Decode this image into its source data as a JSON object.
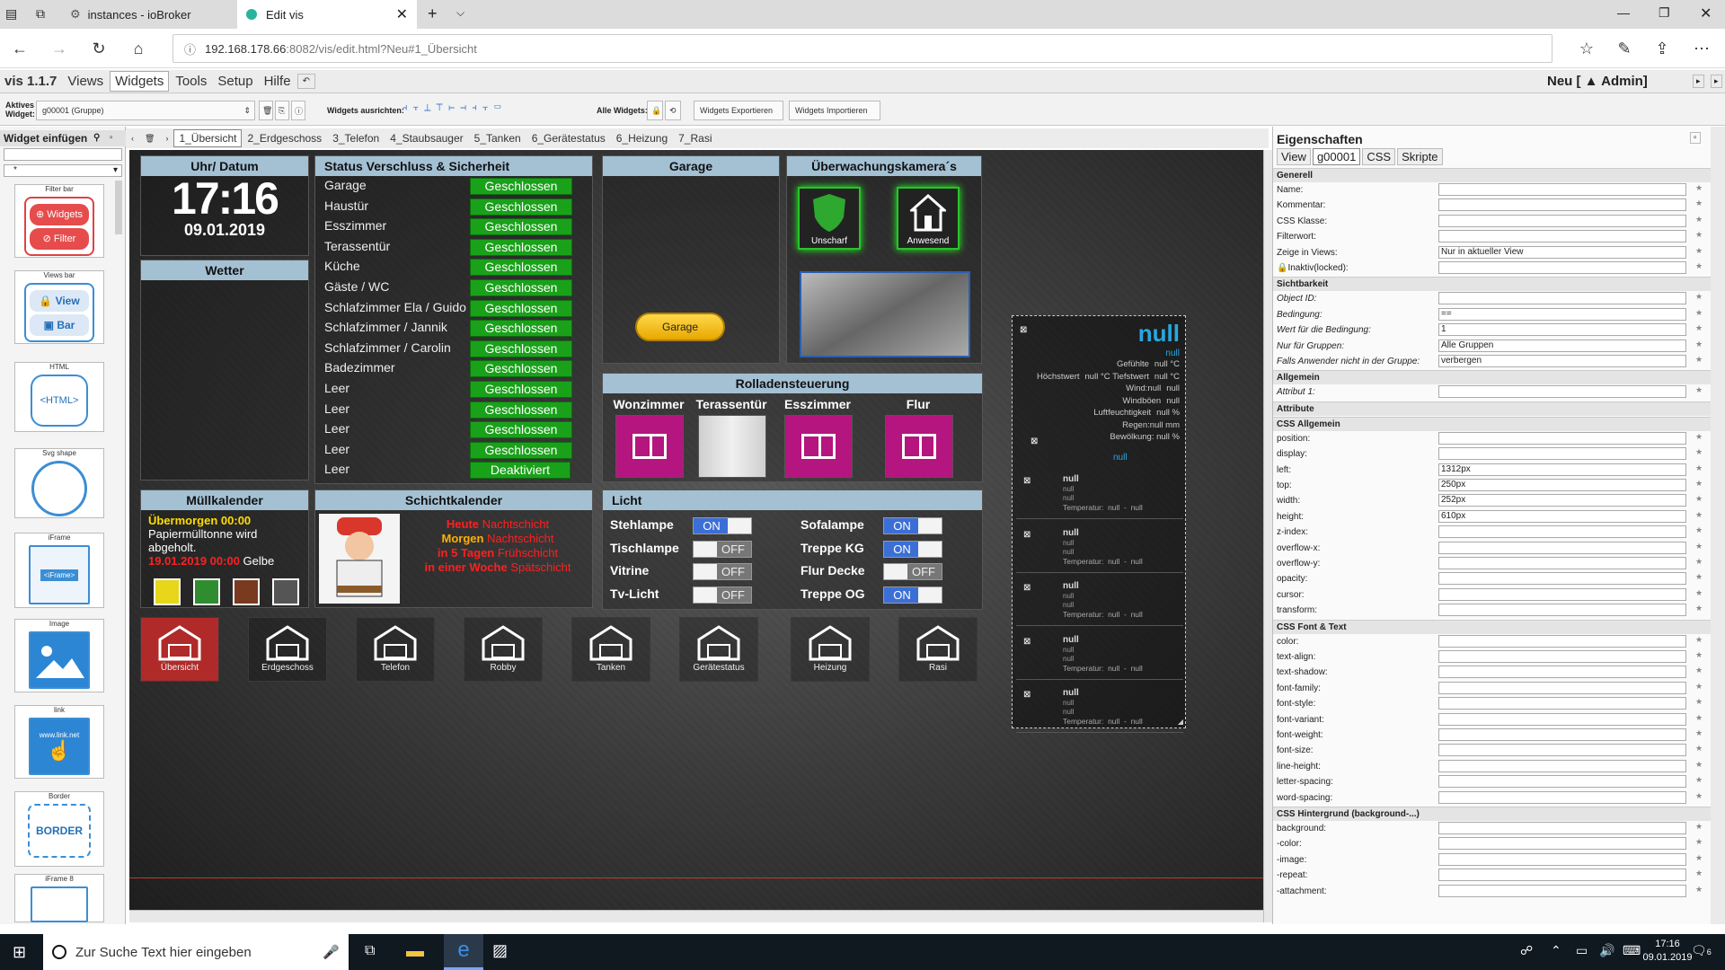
{
  "browser": {
    "tab1": "instances - ioBroker",
    "tab2": "Edit vis",
    "url_host": "192.168.178.66",
    "url_path": ":8082/vis/edit.html?Neu#1_Übersicht"
  },
  "vis": {
    "version": "vis 1.1.7",
    "menu": [
      "Views",
      "Widgets",
      "Tools",
      "Setup",
      "Hilfe"
    ],
    "project": "Neu [ ▲ Admin]"
  },
  "toolbar": {
    "active_label": "Aktives Widget:",
    "active_value": "g00001 (Gruppe)",
    "align_label": "Widgets ausrichten:",
    "all_label": "Alle Widgets:",
    "export": "Widgets Exportieren",
    "import": "Widgets Importieren"
  },
  "left": {
    "title": "Widget einfügen",
    "filter": "*",
    "cards": [
      {
        "label": "Filter bar",
        "a": "Widgets",
        "b": "Filter"
      },
      {
        "label": "Views bar",
        "a": "View",
        "b": "Bar"
      },
      {
        "label": "HTML",
        "a": "<HTML>"
      },
      {
        "label": "Svg shape"
      },
      {
        "label": "iFrame",
        "a": "<iFrame>"
      },
      {
        "label": "Image"
      },
      {
        "label": "link",
        "a": "www.link.net"
      },
      {
        "label": "Border",
        "a": "BORDER"
      },
      {
        "label": "iFrame 8"
      }
    ]
  },
  "view_tabs": [
    "1_Übersicht",
    "2_Erdgeschoss",
    "3_Telefon",
    "4_Staubsauger",
    "5_Tanken",
    "6_Gerätestatus",
    "6_Heizung",
    "7_Rasi"
  ],
  "clock": {
    "title": "Uhr/ Datum",
    "time": "17:16",
    "date": "09.01.2019"
  },
  "weather": {
    "title": "Wetter"
  },
  "status": {
    "title": "Status Verschluss & Sicherheit",
    "rows": [
      [
        "Garage",
        "Geschlossen"
      ],
      [
        "Haustür",
        "Geschlossen"
      ],
      [
        "Esszimmer",
        "Geschlossen"
      ],
      [
        "Terassentür",
        "Geschlossen"
      ],
      [
        "Küche",
        "Geschlossen"
      ],
      [
        "Gäste / WC",
        "Geschlossen"
      ],
      [
        "Schlafzimmer Ela / Guido",
        "Geschlossen"
      ],
      [
        "Schlafzimmer / Jannik",
        "Geschlossen"
      ],
      [
        "Schlafzimmer / Carolin",
        "Geschlossen"
      ],
      [
        "Badezimmer",
        "Geschlossen"
      ],
      [
        "Leer",
        "Geschlossen"
      ],
      [
        "Leer",
        "Geschlossen"
      ],
      [
        "Leer",
        "Geschlossen"
      ],
      [
        "Leer",
        "Geschlossen"
      ],
      [
        "Leer",
        "Deaktiviert"
      ]
    ]
  },
  "garage": {
    "title": "Garage",
    "button": "Garage"
  },
  "camera": {
    "title": "Überwachungskamera´s",
    "btn1": "Unscharf",
    "btn2": "Anwesend"
  },
  "rollo": {
    "title": "Rolladensteuerung",
    "rooms": [
      "Wonzimmer",
      "Terassentür",
      "Esszimmer",
      "Flur"
    ]
  },
  "waste": {
    "title": "Müllkalender",
    "l1": "Übermorgen 00:00",
    "l2": "Papiermülltonne wird abgeholt.",
    "l3a": "19.01.2019 00:00",
    "l3b": " Gelbe"
  },
  "shift": {
    "title": "Schichtkalender",
    "l1a": "Heute",
    "l1b": " Nachtschicht",
    "l2a": "Morgen",
    "l2b": " Nachtschicht",
    "l3a": "in 5 Tagen",
    "l3b": " Frühschicht",
    "l4a": "in einer Woche",
    "l4b": " Spätschicht"
  },
  "light": {
    "title": "Licht",
    "items": [
      {
        "name": "Stehlampe",
        "state": "ON"
      },
      {
        "name": "Tischlampe",
        "state": "OFF"
      },
      {
        "name": "Vitrine",
        "state": "OFF"
      },
      {
        "name": "Tv-Licht",
        "state": "OFF"
      },
      {
        "name": "Sofalampe",
        "state": "ON"
      },
      {
        "name": "Treppe KG",
        "state": "ON"
      },
      {
        "name": "Flur Decke",
        "state": "OFF"
      },
      {
        "name": "Treppe OG",
        "state": "ON"
      }
    ]
  },
  "nav": [
    "Übersicht",
    "Erdgeschoss",
    "Telefon",
    "Robby",
    "Tanken",
    "Gerätestatus",
    "Heizung",
    "Rasi"
  ],
  "weather_widget": {
    "big": "null",
    "small": "null",
    "rows": [
      "Gefühlte",
      "null °C",
      "Höchstwert",
      "null °C Tiefstwert",
      "null °C",
      "Wind:null",
      "null",
      "Windböen",
      "null",
      "Luftfeuchtigkeit",
      "null %",
      "Regen:null mm",
      "Bewölkung: null %"
    ],
    "mid": "null",
    "days": [
      {
        "t": "null",
        "l": [
          "null",
          "null"
        ],
        "temp": "Temperatur:  null  -  null"
      },
      {
        "t": "null",
        "l": [
          "null",
          "null"
        ],
        "temp": "Temperatur:  null  -  null"
      },
      {
        "t": "null",
        "l": [
          "null",
          "null"
        ],
        "temp": "Temperatur:  null  -  null"
      },
      {
        "t": "null",
        "l": [
          "null",
          "null"
        ],
        "temp": "Temperatur:  null  -  null"
      },
      {
        "t": "null",
        "l": [
          "null",
          "null"
        ],
        "temp": "Temperatur:  null  -  null"
      }
    ]
  },
  "props": {
    "title": "Eigenschaften",
    "tabs": [
      "View",
      "g00001",
      "CSS",
      "Skripte"
    ],
    "generell": "Generell",
    "gen_rows": [
      "Name:",
      "Kommentar:",
      "CSS Klasse:",
      "Filterwort:",
      "Zeige in Views:",
      "🔒Inaktiv(locked):"
    ],
    "zeige_value": "Nur in aktueller View",
    "sicht": "Sichtbarkeit",
    "sicht_rows": [
      "Object ID:",
      "Bedingung:",
      "Wert für die Bedingung:",
      "Nur für Gruppen:",
      "Falls Anwender nicht in der Gruppe:"
    ],
    "bed_value": "==",
    "wert_value": "1",
    "gruppen_value": "Alle Gruppen",
    "falls_value": "verbergen",
    "allgemein": "Allgemein",
    "attr1": "Attribut 1:",
    "attribute": "Attribute",
    "cssallg": "CSS Allgemein",
    "css_rows": [
      "position:",
      "display:",
      "left:",
      "top:",
      "width:",
      "height:",
      "z-index:",
      "overflow-x:",
      "overflow-y:",
      "opacity:",
      "cursor:",
      "transform:"
    ],
    "css_vals": [
      "",
      "",
      "1312px",
      "250px",
      "252px",
      "610px",
      "",
      "",
      "",
      "",
      "",
      ""
    ],
    "font": "CSS Font & Text",
    "font_rows": [
      "color:",
      "text-align:",
      "text-shadow:",
      "font-family:",
      "font-style:",
      "font-variant:",
      "font-weight:",
      "font-size:",
      "line-height:",
      "letter-spacing:",
      "word-spacing:"
    ],
    "bg": "CSS Hintergrund (background-...)",
    "bg_rows": [
      "background:",
      "-color:",
      "-image:",
      "-repeat:",
      "-attachment:"
    ],
    "px": "px"
  },
  "taskbar": {
    "search": "Zur Suche Text hier eingeben",
    "time": "17:16",
    "date": "09.01.2019",
    "notif": "6"
  }
}
